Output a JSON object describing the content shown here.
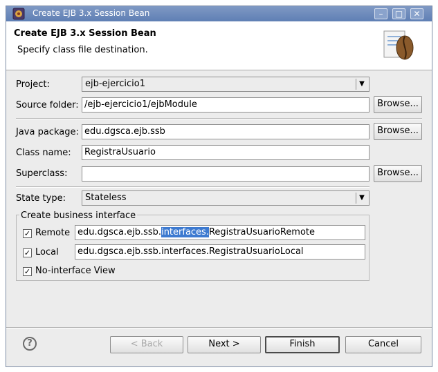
{
  "window": {
    "title": "Create EJB 3.x Session Bean",
    "minimize_icon": "minimize-icon",
    "maximize_icon": "maximize-icon",
    "close_icon": "close-icon"
  },
  "header": {
    "title": "Create EJB 3.x Session Bean",
    "subtitle": "Specify class file destination.",
    "banner_icon": "coffee-bean-icon"
  },
  "form": {
    "project_label": "Project:",
    "project_value": "ejb-ejercicio1",
    "source_folder_label": "Source folder:",
    "source_folder_value": "/ejb-ejercicio1/ejbModule",
    "java_package_label": "Java package:",
    "java_package_value": "edu.dgsca.ejb.ssb",
    "class_name_label": "Class name:",
    "class_name_value": "RegistraUsuario",
    "superclass_label": "Superclass:",
    "superclass_value": "",
    "browse_label": "Browse...",
    "state_type_label": "State type:",
    "state_type_value": "Stateless"
  },
  "business_interface": {
    "group_label": "Create business interface",
    "remote_label": "Remote",
    "remote_checked": true,
    "remote_value_prefix": "edu.dgsca.ejb.ssb.",
    "remote_value_selected": "interfaces.",
    "remote_value_suffix": "RegistraUsuarioRemote",
    "local_label": "Local",
    "local_checked": true,
    "local_value": "edu.dgsca.ejb.ssb.interfaces.RegistraUsuarioLocal",
    "no_interface_label": "No-interface View",
    "no_interface_checked": true
  },
  "footer": {
    "help_icon": "help-icon",
    "back_label": "< Back",
    "next_label": "Next >",
    "finish_label": "Finish",
    "cancel_label": "Cancel"
  },
  "check_glyph": "✓",
  "colors": {
    "titlebar": "#6f8cbe",
    "selection": "#3d7ad0"
  }
}
